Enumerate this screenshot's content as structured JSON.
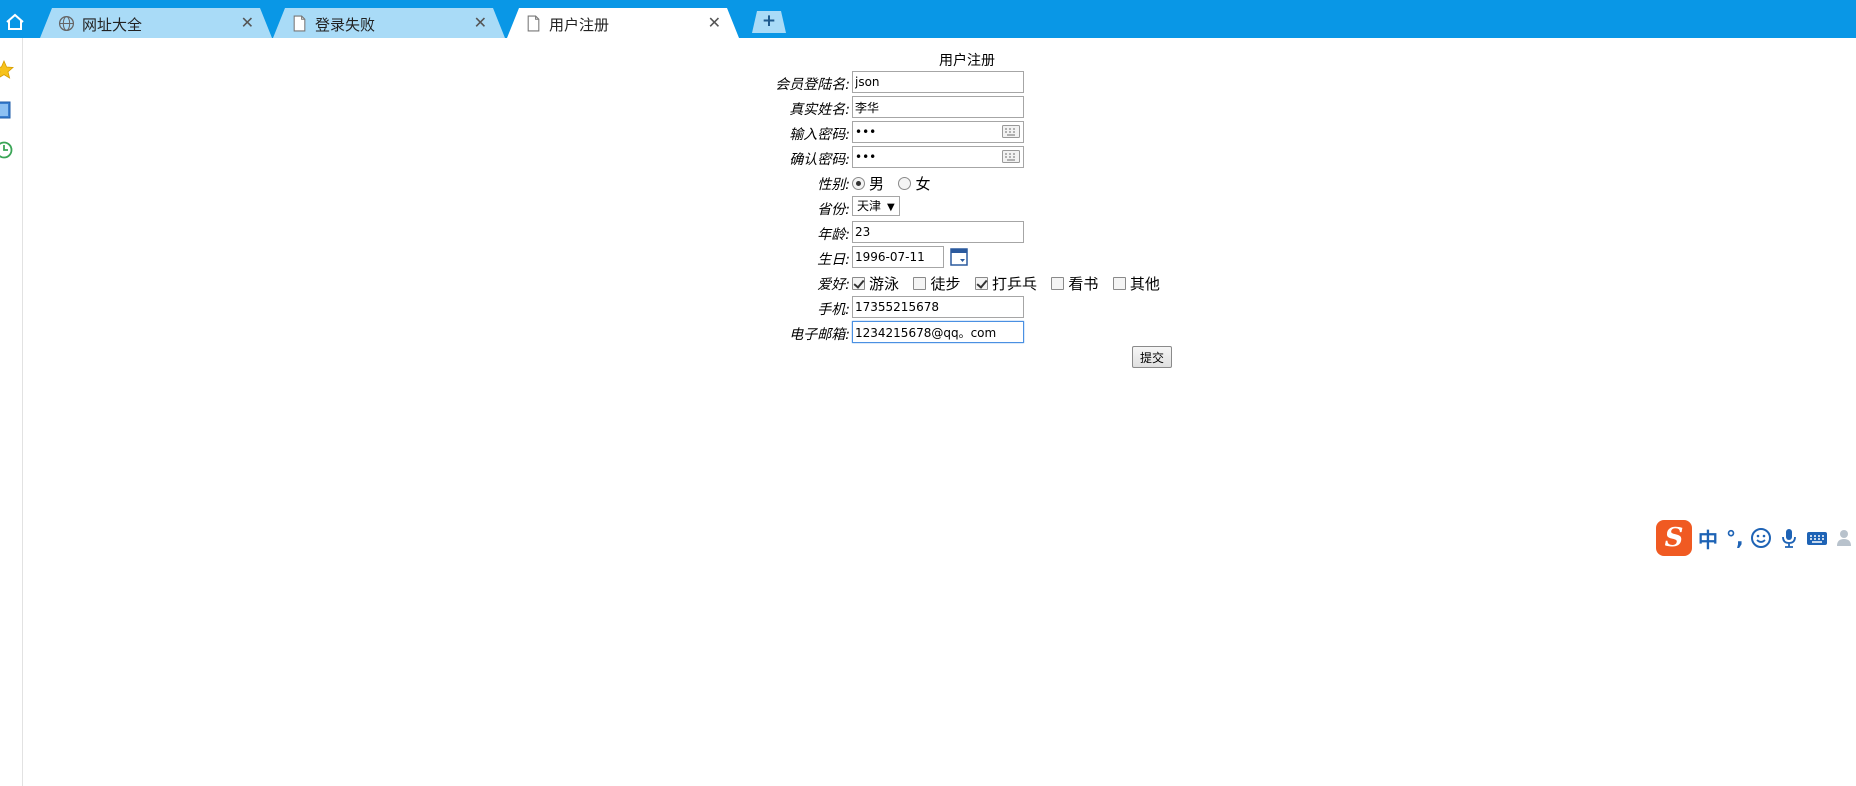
{
  "browser": {
    "tabs": [
      {
        "title": "网址大全",
        "icon": "globe-icon",
        "active": false
      },
      {
        "title": "登录失败",
        "icon": "page-icon",
        "active": false
      },
      {
        "title": "用户注册",
        "icon": "page-icon",
        "active": true
      }
    ],
    "close_glyph": "✕",
    "new_tab_glyph": "+"
  },
  "form": {
    "title": "用户注册",
    "username": {
      "label": "会员登陆名:",
      "value": "json"
    },
    "realname": {
      "label": "真实姓名:",
      "value": "李华"
    },
    "password": {
      "label": "输入密码:",
      "value": "•••"
    },
    "confirm": {
      "label": "确认密码:",
      "value": "•••"
    },
    "gender": {
      "label": "性别:",
      "options": [
        "男",
        "女"
      ],
      "selected": "男"
    },
    "province": {
      "label": "省份:",
      "value": "天津",
      "arrow": "▼"
    },
    "age": {
      "label": "年龄:",
      "value": "23"
    },
    "birthday": {
      "label": "生日:",
      "value": "1996-07-11"
    },
    "hobbies": {
      "label": "爱好:",
      "options": [
        {
          "text": "游泳",
          "checked": true
        },
        {
          "text": "徒步",
          "checked": false
        },
        {
          "text": "打乒乓",
          "checked": true
        },
        {
          "text": "看书",
          "checked": false
        },
        {
          "text": "其他",
          "checked": false
        }
      ]
    },
    "phone": {
      "label": "手机:",
      "value": "17355215678"
    },
    "email": {
      "label": "电子邮箱:",
      "value": "1234215678@qq。com"
    },
    "submit_label": "提交"
  },
  "ime": {
    "logo": "S",
    "mode": "中",
    "punct": "°,"
  },
  "colors": {
    "tabbar": "#0997e6",
    "tab_inactive": "#a9dbf7",
    "ime_logo": "#f05a22",
    "ime_blue": "#1e63b5"
  }
}
